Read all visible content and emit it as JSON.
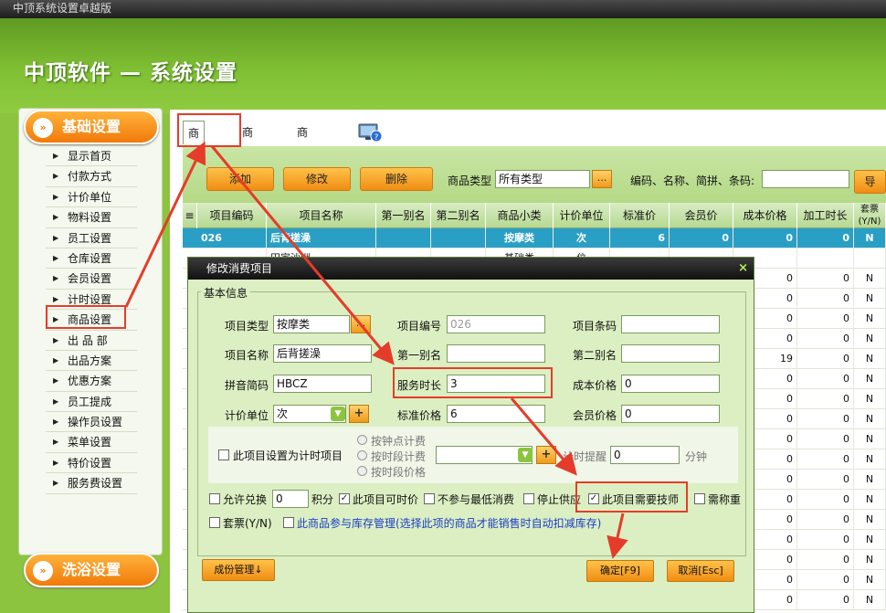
{
  "window": {
    "title": "中顶系统设置卓越版"
  },
  "header": {
    "title": "中顶软件 — 系统设置"
  },
  "sidebar": {
    "section1": "基础设置",
    "section2": "洗浴设置",
    "items": [
      "显示首页",
      "付款方式",
      "计价单位",
      "物料设置",
      "员工设置",
      "仓库设置",
      "会员设置",
      "计时设置",
      "商品设置",
      "出 品 部",
      "出品方案",
      "优惠方案",
      "员工提成",
      "操作员设置",
      "菜单设置",
      "特价设置",
      "服务费设置"
    ]
  },
  "tabs": [
    "商品信息",
    "商品大类",
    "商品小类"
  ],
  "toolbar": {
    "add": "添加",
    "edit": "修改",
    "delete": "删除",
    "type_label": "商品类型",
    "type_value": "所有类型",
    "dots": "...",
    "search_label": "编码、名称、简拼、条码:",
    "export": "导"
  },
  "grid": {
    "columns": [
      "项目编码",
      "项目名称",
      "第一别名",
      "第二别名",
      "商品小类",
      "计价单位",
      "标准价",
      "会员价",
      "成本价格",
      "加工时长",
      "套票(Y/N)"
    ],
    "selected_row": [
      "026",
      "后背搓澡",
      "",
      "",
      "按摩类",
      "次",
      "6",
      "0",
      "0",
      "0",
      "N"
    ],
    "row2": [
      "",
      "田家沙洲",
      "",
      "",
      "基础类",
      "位",
      "",
      "",
      "",
      "",
      ""
    ],
    "rest_values": [
      [
        "0",
        "0",
        "N"
      ],
      [
        "0",
        "0",
        "N"
      ],
      [
        "0",
        "0",
        "N"
      ],
      [
        "0",
        "0",
        "N"
      ],
      [
        "19",
        "0",
        "N"
      ],
      [
        "0",
        "0",
        "N"
      ],
      [
        "0",
        "0",
        "N"
      ],
      [
        "0",
        "0",
        "N"
      ],
      [
        "0",
        "0",
        "N"
      ],
      [
        "0",
        "0",
        "N"
      ],
      [
        "0",
        "0",
        "N"
      ],
      [
        "0",
        "0",
        "N"
      ],
      [
        "0",
        "0",
        "N"
      ],
      [
        "0",
        "0",
        "N"
      ],
      [
        "0",
        "0",
        "N"
      ],
      [
        "0",
        "0",
        "N"
      ],
      [
        "0",
        "0",
        "N"
      ]
    ]
  },
  "dialog": {
    "title": "修改消费项目",
    "close": "×",
    "legend": "基本信息",
    "item_type_label": "项目类型",
    "item_type": "按摩类",
    "item_code_label": "项目编号",
    "item_code": "026",
    "barcode_label": "项目条码",
    "barcode": "",
    "name_label": "项目名称",
    "name": "后背搓澡",
    "alias1_label": "第一别名",
    "alias1": "",
    "alias2_label": "第二别名",
    "alias2": "",
    "pinyin_label": "拼音简码",
    "pinyin": "HBCZ",
    "duration_label": "服务时长",
    "duration": "3",
    "cost_label": "成本价格",
    "cost": "0",
    "unit_label": "计价单位",
    "unit": "次",
    "std_price_label": "标准价格",
    "std_price": "6",
    "member_price_label": "会员价格",
    "member_price": "0",
    "timed_label": "此项目设置为计时项目",
    "radio1": "按钟点计费",
    "radio2": "按时段计费",
    "radio3": "按时段价格",
    "remind_label": "计时提醒",
    "remind": "0",
    "minute": "分钟",
    "exchange_label": "允许兑换",
    "points": "0",
    "points_unit": "积分",
    "timing_price": "此项目可时价",
    "no_min": "不参与最低消费",
    "stop_supply": "停止供应",
    "need_tech": "此项目需要技师",
    "need_weigh": "需称重",
    "package": "套票(Y/N)",
    "stock": "此商品参与库存管理(选择此项的商品才能销售时自动扣减库存)",
    "components": "成份管理↓",
    "ok": "确定[F9]",
    "cancel": "取消[Esc]"
  },
  "colors": {
    "accent_orange": "#f08d14",
    "annotation_red": "#e53c2a",
    "header_green": "#80c034",
    "selected_row": "#2a9fc6"
  }
}
